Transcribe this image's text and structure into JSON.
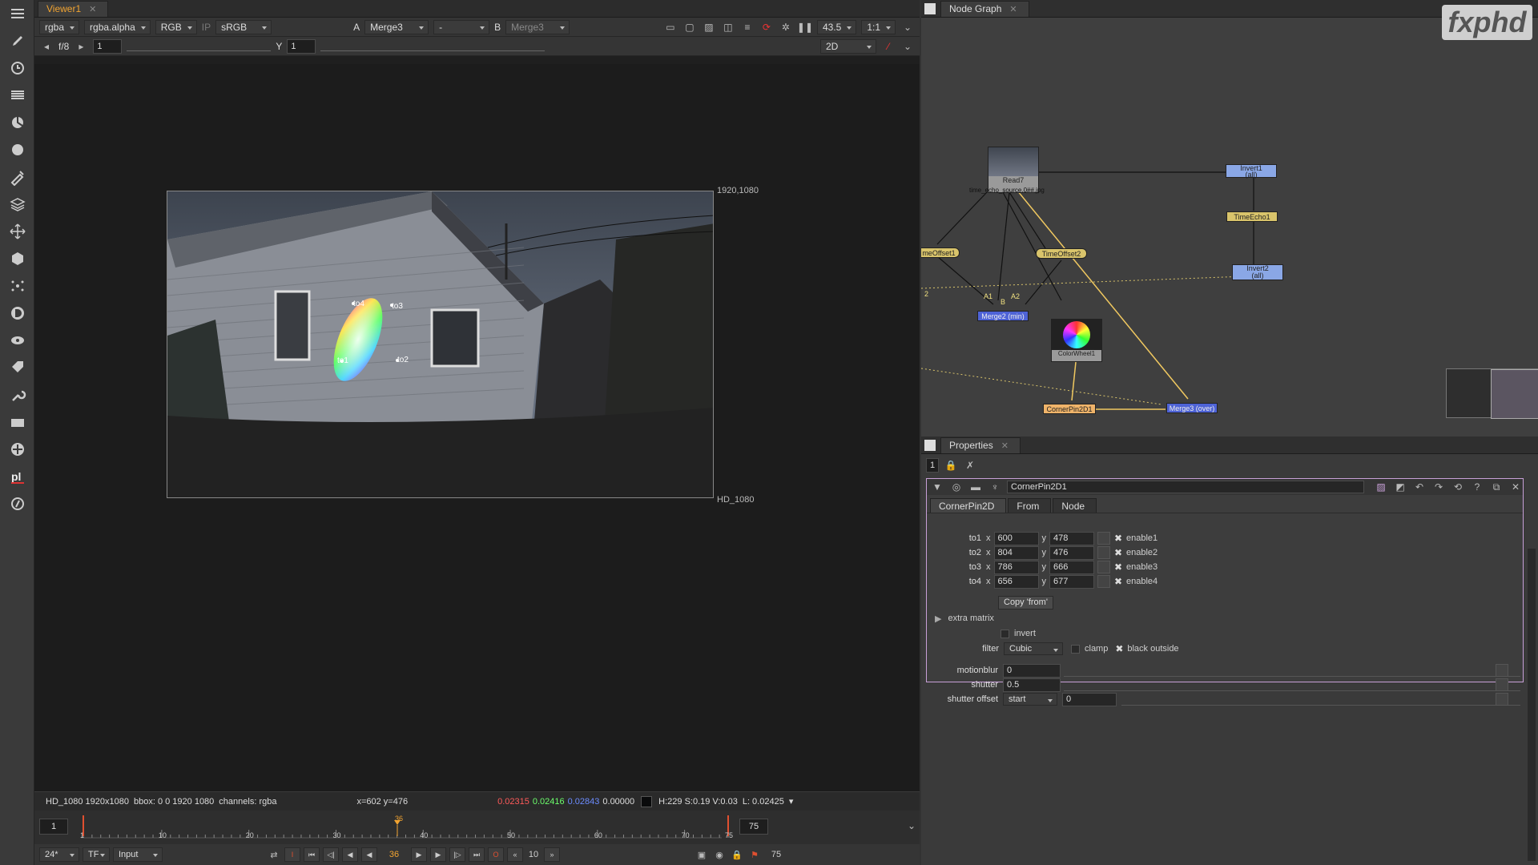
{
  "viewer": {
    "tab_label": "Viewer1",
    "channels": "rgba",
    "alpha_channel": "rgba.alpha",
    "color_space": "RGB",
    "ip_label": "IP",
    "lut": "sRGB",
    "a_label": "A",
    "a_input": "Merge3",
    "blend_mode": "-",
    "b_label": "B",
    "b_input": "Merge3",
    "zoom": "43.5",
    "ratio": "1:1",
    "fstop": "f/8",
    "gain_value": "1",
    "gamma_label": "Y",
    "gamma_value": "1",
    "view_mode": "2D",
    "format_top_right": "1920,1080",
    "format_bottom_right": "HD_1080",
    "points": [
      "to1",
      "to2",
      "to3",
      "to4"
    ]
  },
  "status": {
    "format": "HD_1080 1920x1080",
    "bbox": "bbox: 0 0 1920 1080",
    "channels": "channels: rgba",
    "coords": "x=602 y=476",
    "r": "0.02315",
    "g": "0.02416",
    "b": "0.02843",
    "a": "0.00000",
    "hsv": "H:229 S:0.19 V:0.03",
    "lum": "L: 0.02425"
  },
  "timeline": {
    "start": "1",
    "end": "75",
    "current": "36",
    "ticks": [
      "1",
      "10",
      "20",
      "30",
      "40",
      "50",
      "60",
      "70",
      "75"
    ],
    "fps": "24*",
    "tf": "TF",
    "input_mode": "Input",
    "step": "10",
    "end_frame_field": "75"
  },
  "nodegraph": {
    "tab_label": "Node Graph",
    "logo": "fxphd",
    "nodes": {
      "read": "Read7",
      "read_file": "time_echo_source.0##.jpg",
      "invert1": "Invert1",
      "invert1_sub": "(all)",
      "timeecho": "TimeEcho1",
      "invert2": "Invert2",
      "invert2_sub": "(all)",
      "timeoffset1": "meOffset1",
      "timeoffset2": "TimeOffset2",
      "merge2": "Merge2 (min)",
      "colorwheel": "ColorWheel1",
      "cornerpin": "CornerPin2D1",
      "merge3": "Merge3 (over)",
      "pin_a1": "A1",
      "pin_b": "B",
      "pin_a2": "A2",
      "pin_2": "2"
    }
  },
  "properties": {
    "tab_label": "Properties",
    "count": "1",
    "node_name": "CornerPin2D1",
    "tabs": [
      "CornerPin2D",
      "From",
      "Node"
    ],
    "to": [
      {
        "label": "to1",
        "x": "600",
        "y": "478",
        "enable": "enable1"
      },
      {
        "label": "to2",
        "x": "804",
        "y": "476",
        "enable": "enable2"
      },
      {
        "label": "to3",
        "x": "786",
        "y": "666",
        "enable": "enable3"
      },
      {
        "label": "to4",
        "x": "656",
        "y": "677",
        "enable": "enable4"
      }
    ],
    "x_label": "x",
    "y_label": "y",
    "copy_from": "Copy 'from'",
    "extra_matrix": "extra matrix",
    "invert": "invert",
    "filter_label": "filter",
    "filter_value": "Cubic",
    "clamp": "clamp",
    "black_outside": "black outside",
    "motionblur_label": "motionblur",
    "motionblur_value": "0",
    "shutter_label": "shutter",
    "shutter_value": "0.5",
    "shutter_offset_label": "shutter offset",
    "shutter_offset_mode": "start",
    "shutter_offset_value": "0"
  }
}
